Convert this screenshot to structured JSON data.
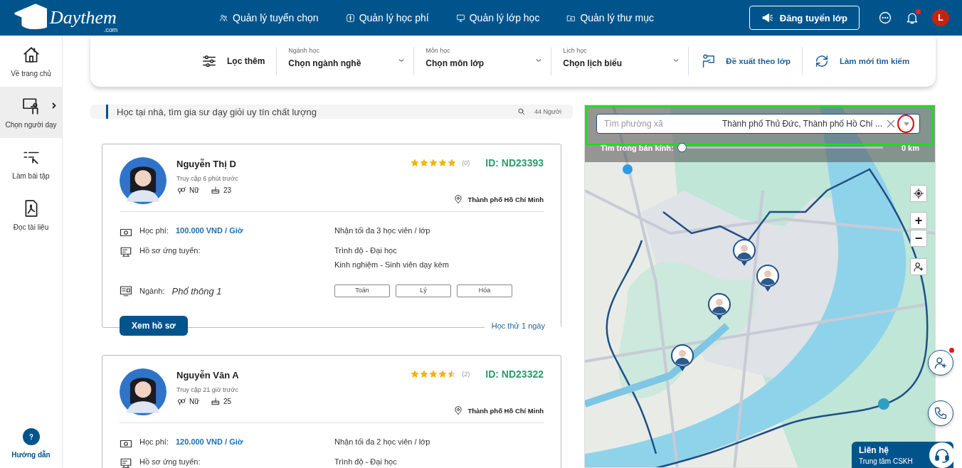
{
  "header": {
    "logo": {
      "text": "Daythem",
      "sub": ".com"
    },
    "nav": [
      {
        "label": "Quản lý tuyển chọn"
      },
      {
        "label": "Quản lý học phí"
      },
      {
        "label": "Quản lý lớp học"
      },
      {
        "label": "Quản lý thư mục"
      }
    ],
    "post_button": "Đăng tuyển lớp",
    "unread_notifications": true,
    "avatar_letter": "L"
  },
  "sidebar": {
    "items": [
      {
        "label": "Về trang chủ",
        "selected": false
      },
      {
        "label": "Chọn người dạy",
        "selected": true
      },
      {
        "label": "Làm bài tập",
        "selected": false
      },
      {
        "label": "Đọc tài liệu",
        "selected": false
      }
    ],
    "help": "Hướng dẫn"
  },
  "filters": {
    "more_label": "Lọc thêm",
    "dropdowns": [
      {
        "label": "Ngành học",
        "value": "Chọn ngành nghề"
      },
      {
        "label": "Môn học",
        "value": "Chọn môn lớp"
      },
      {
        "label": "Lịch học",
        "value": "Chọn lịch biểu"
      }
    ],
    "actions": [
      {
        "label": "Đề xuất theo lớp"
      },
      {
        "label": "Làm mới tìm kiếm"
      }
    ]
  },
  "search_banner": {
    "text": "Học tại nhà, tìm gia sư dạy giỏi uy tín chất lượng",
    "count": "44 Người"
  },
  "tutors": [
    {
      "name": "Nguyễn Thị D",
      "last_seen": "Truy cập 6 phút trước",
      "gender": "Nữ",
      "age": "23",
      "location": "Thành phố Hồ Chí Minh",
      "stars": 5,
      "reviews": "(0)",
      "id": "ID: ND23393",
      "fee_label": "Học phí:",
      "fee": "100.000 VND / Giờ",
      "capacity": "Nhận tối đa 3 học viên / lớp",
      "profile_label": "Hồ sơ ứng tuyển:",
      "level": "Trình độ - Đại học",
      "experience": "Kinh nghiệm - Sinh viên dạy kèm",
      "major_label": "Ngành:",
      "major": "Phổ thông 1",
      "subjects": [
        "Toán",
        "Lý",
        "Hóa"
      ],
      "view_button": "Xem hồ sơ",
      "trial": "Học thử 1 ngày"
    },
    {
      "name": "Nguyễn Văn A",
      "last_seen": "Truy cập 21 giờ trước",
      "gender": "Nữ",
      "age": "25",
      "location": "Thành phố Hồ Chí Minh",
      "stars": 4.5,
      "reviews": "(2)",
      "id": "ID: ND23322",
      "fee_label": "Học phí:",
      "fee": "120.000 VND / Giờ",
      "capacity": "Nhận tối đa 2 học viên / lớp",
      "profile_label": "Hồ sơ ứng tuyển:",
      "level": "Trình độ - Đại học"
    }
  ],
  "map": {
    "search": {
      "placeholder": "Tìm phường xã",
      "value": "Thành phố Thủ Đức, Thành phố Hồ Chí ..."
    },
    "radius": {
      "label": "Tìm trong bán kính:",
      "level": 0,
      "reading": "0 km"
    },
    "zoom_in": "+",
    "zoom_out": "−"
  },
  "floating": {
    "invite_badge": true,
    "contact": {
      "title": "Liên hệ",
      "subtitle": "Trung tâm CSKH"
    }
  }
}
